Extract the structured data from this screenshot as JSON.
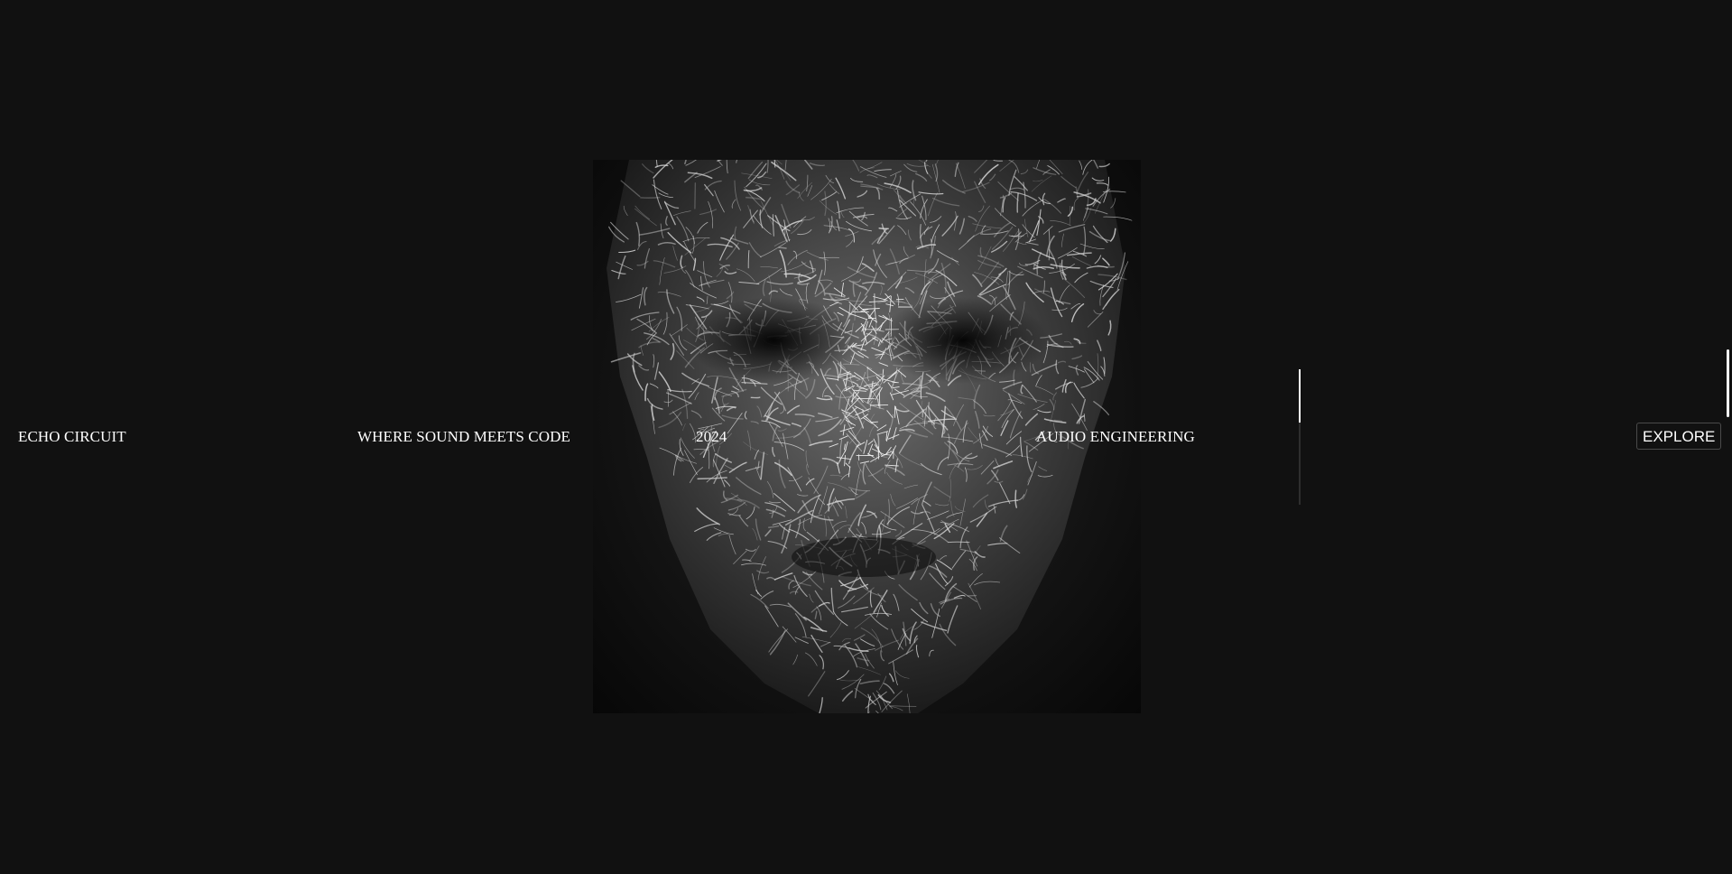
{
  "header": {
    "brand": "ECHO CIRCUIT",
    "tagline": "WHERE SOUND MEETS CODE",
    "year": "2024",
    "discipline": "AUDIO ENGINEERING",
    "explore_label": "EXPLORE"
  },
  "hero": {
    "image_subject": "wire-sculpture-face"
  },
  "progress": {
    "fraction": 0.39
  },
  "colors": {
    "background": "#111111",
    "text": "#ffffff"
  }
}
